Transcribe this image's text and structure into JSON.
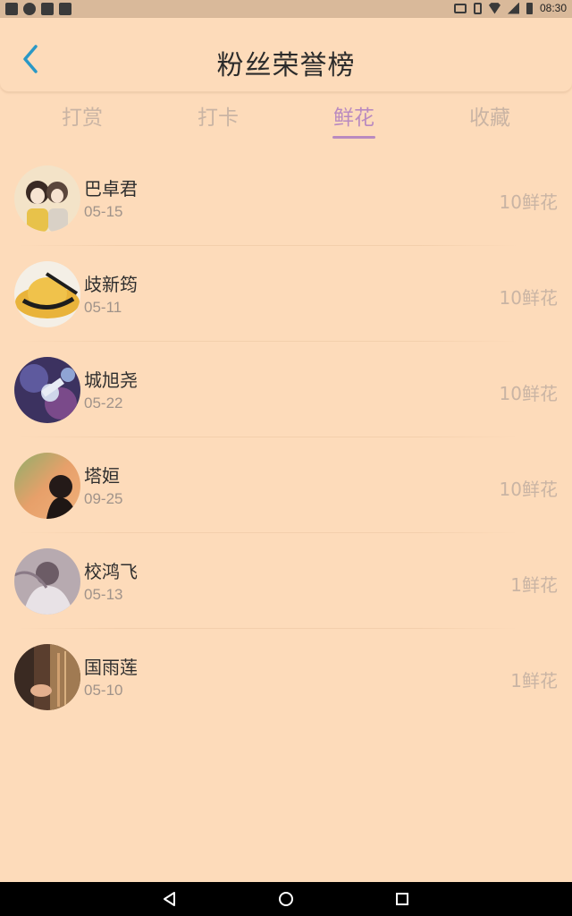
{
  "status_bar": {
    "time": "08:30"
  },
  "header": {
    "title": "粉丝荣誉榜"
  },
  "tabs": [
    {
      "label": "打赏",
      "active": false
    },
    {
      "label": "打卡",
      "active": false
    },
    {
      "label": "鲜花",
      "active": true
    },
    {
      "label": "收藏",
      "active": false
    }
  ],
  "colors": {
    "background": "#fddbba",
    "accent": "#b98ac0",
    "muted": "#c9b4a4"
  },
  "fans": [
    {
      "name": "巴卓君",
      "date": "05-15",
      "amount": "10鲜花"
    },
    {
      "name": "歧新筠",
      "date": "05-11",
      "amount": "10鲜花"
    },
    {
      "name": "城旭尧",
      "date": "05-22",
      "amount": "10鲜花"
    },
    {
      "name": "塔姮",
      "date": "09-25",
      "amount": "10鲜花"
    },
    {
      "name": "校鸿飞",
      "date": "05-13",
      "amount": "1鲜花"
    },
    {
      "name": "国雨莲",
      "date": "05-10",
      "amount": "1鲜花"
    }
  ]
}
